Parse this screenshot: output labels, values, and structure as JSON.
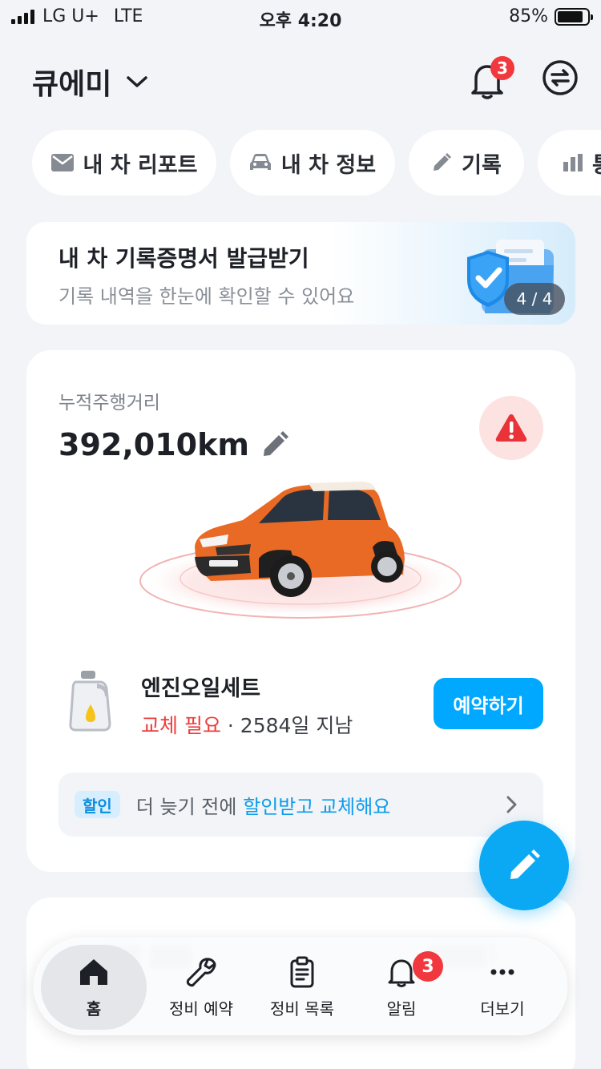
{
  "status_bar": {
    "carrier": "LG U+",
    "network": "LTE",
    "time": "오후 4:20",
    "battery_percent": "85%",
    "battery_level": 0.85
  },
  "header": {
    "car_name": "큐에미",
    "notification_count": "3"
  },
  "chips": [
    {
      "label": "내 차 리포트",
      "icon": "mail-icon"
    },
    {
      "label": "내 차 정보",
      "icon": "car-icon"
    },
    {
      "label": "기록",
      "icon": "pencil-icon"
    },
    {
      "label": "통",
      "icon": "bar-chart-icon"
    }
  ],
  "banner": {
    "title": "내 차 기록증명서 발급받기",
    "subtitle": "기록 내역을 한눈에 확인할 수 있어요",
    "page_indicator": "4 / 4"
  },
  "mileage": {
    "label": "누적주행거리",
    "value": "392,010km"
  },
  "maintenance": {
    "item": "엔진오일세트",
    "status": "교체 필요",
    "separator": " · ",
    "elapsed": "2584일 지남",
    "action": "예약하기"
  },
  "promo": {
    "tag": "할인",
    "text_prefix": "더 늦기 전에 ",
    "text_highlight": "할인받고 교체해요"
  },
  "tab_bar": {
    "items": [
      {
        "label": "홈",
        "icon": "home-icon",
        "active": true
      },
      {
        "label": "정비 예약",
        "icon": "wrench-icon"
      },
      {
        "label": "정비 목록",
        "icon": "clipboard-icon"
      },
      {
        "label": "알림",
        "icon": "bell-icon",
        "badge": "3"
      },
      {
        "label": "더보기",
        "icon": "more-icon"
      }
    ]
  },
  "colors": {
    "accent": "#00a8ff",
    "warning": "#ee3b3b",
    "background": "#f2f4f7",
    "badge": "#f0383e"
  }
}
